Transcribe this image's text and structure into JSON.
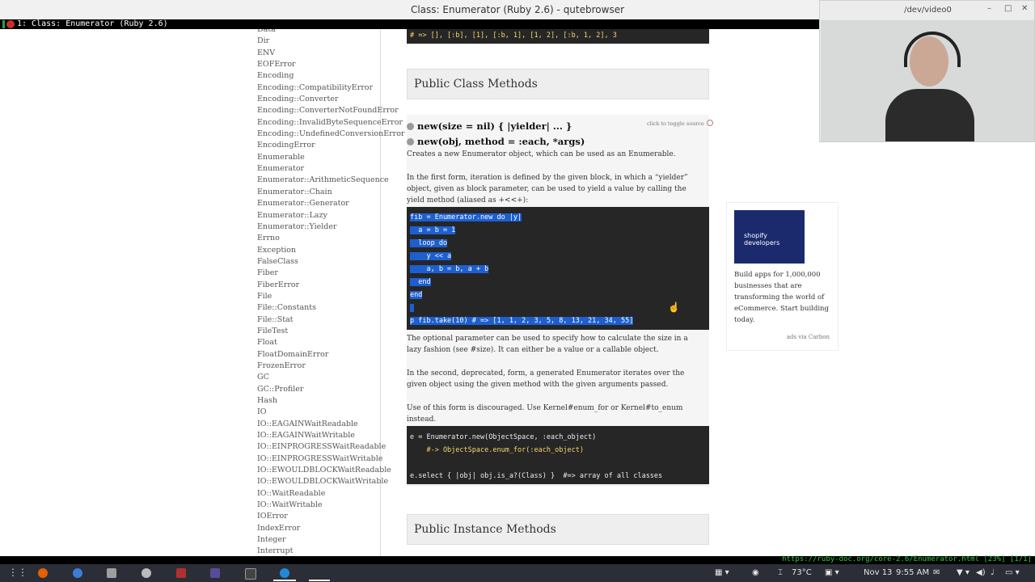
{
  "window": {
    "title": "Class: Enumerator (Ruby 2.6) - qutebrowser"
  },
  "tab": {
    "label": "1: Class: Enumerator (Ruby 2.6)"
  },
  "sidebar": {
    "items": [
      "Data",
      "Dir",
      "ENV",
      "EOFError",
      "Encoding",
      "Encoding::CompatibilityError",
      "Encoding::Converter",
      "Encoding::ConverterNotFoundError",
      "Encoding::InvalidByteSequenceError",
      "Encoding::UndefinedConversionError",
      "EncodingError",
      "Enumerable",
      "Enumerator",
      "Enumerator::ArithmeticSequence",
      "Enumerator::Chain",
      "Enumerator::Generator",
      "Enumerator::Lazy",
      "Enumerator::Yielder",
      "Errno",
      "Exception",
      "FalseClass",
      "Fiber",
      "FiberError",
      "File",
      "File::Constants",
      "File::Stat",
      "FileTest",
      "Float",
      "FloatDomainError",
      "FrozenError",
      "GC",
      "GC::Profiler",
      "Hash",
      "IO",
      "IO::EAGAINWaitReadable",
      "IO::EAGAINWaitWritable",
      "IO::EINPROGRESSWaitReadable",
      "IO::EINPROGRESSWaitWritable",
      "IO::EWOULDBLOCKWaitReadable",
      "IO::EWOULDBLOCKWaitWritable",
      "IO::WaitReadable",
      "IO::WaitWritable",
      "IOError",
      "IndexError",
      "Integer",
      "Interrupt"
    ]
  },
  "main": {
    "top_code": "# => [], [:b], [1], [:b, 1], [1, 2], [:b, 1, 2], 3",
    "public_class_methods": "Public Class Methods",
    "toggle_source": "click to toggle source",
    "sig1": "new(size = nil) { |yielder| ... }",
    "sig2": "new(obj, method = :each, *args)",
    "p1": "Creates a new Enumerator object, which can be used as an Enumerable.",
    "p2": "In the first form, iteration is defined by the given block, in which a “yielder” object, given as block parameter, can be used to yield a value by calling the yield method (aliased as +<<+):",
    "code1": [
      "fib = Enumerator.new do |y|",
      "  a = b = 1",
      "  loop do",
      "    y << a",
      "    a, b = b, a + b",
      "  end",
      "end",
      "",
      "p fib.take(10) # => [1, 1, 2, 3, 5, 8, 13, 21, 34, 55]"
    ],
    "p3": "The optional parameter can be used to specify how to calculate the size in a lazy fashion (see #size). It can either be a value or a callable object.",
    "p4": "In the second, deprecated, form, a generated Enumerator iterates over the given object using the given method with the given arguments passed.",
    "p5": "Use of this form is discouraged. Use Kernel#enum_for or Kernel#to_enum instead.",
    "code2": [
      "e = Enumerator.new(ObjectSpace, :each_object)",
      "    #-> ObjectSpace.enum_for(:each_object)",
      "",
      "e.select { |obj| obj.is_a?(Class) }  #=> array of all classes"
    ],
    "public_instance_methods": "Public Instance Methods"
  },
  "ad": {
    "brand": "shopify developers",
    "text": "Build apps for 1,000,000 businesses that are transforming the world of eCommerce. Start building today.",
    "via": "ads via Carbon"
  },
  "webcam": {
    "title": "/dev/video0"
  },
  "statusbar": {
    "url": "https://ruby-doc.org/core-2.6/Enumerator.html [23%] [1/1]"
  },
  "taskbar": {
    "temperature": "73°C",
    "date": "Nov 13",
    "time": "9:55 AM"
  }
}
